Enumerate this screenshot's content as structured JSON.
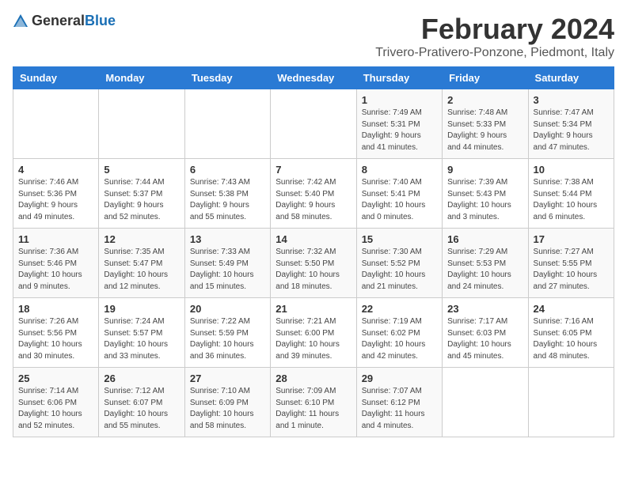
{
  "header": {
    "logo_general": "General",
    "logo_blue": "Blue",
    "title": "February 2024",
    "subtitle": "Trivero-Prativero-Ponzone, Piedmont, Italy"
  },
  "weekdays": [
    "Sunday",
    "Monday",
    "Tuesday",
    "Wednesday",
    "Thursday",
    "Friday",
    "Saturday"
  ],
  "weeks": [
    [
      {
        "day": "",
        "info": ""
      },
      {
        "day": "",
        "info": ""
      },
      {
        "day": "",
        "info": ""
      },
      {
        "day": "",
        "info": ""
      },
      {
        "day": "1",
        "info": "Sunrise: 7:49 AM\nSunset: 5:31 PM\nDaylight: 9 hours\nand 41 minutes."
      },
      {
        "day": "2",
        "info": "Sunrise: 7:48 AM\nSunset: 5:33 PM\nDaylight: 9 hours\nand 44 minutes."
      },
      {
        "day": "3",
        "info": "Sunrise: 7:47 AM\nSunset: 5:34 PM\nDaylight: 9 hours\nand 47 minutes."
      }
    ],
    [
      {
        "day": "4",
        "info": "Sunrise: 7:46 AM\nSunset: 5:36 PM\nDaylight: 9 hours\nand 49 minutes."
      },
      {
        "day": "5",
        "info": "Sunrise: 7:44 AM\nSunset: 5:37 PM\nDaylight: 9 hours\nand 52 minutes."
      },
      {
        "day": "6",
        "info": "Sunrise: 7:43 AM\nSunset: 5:38 PM\nDaylight: 9 hours\nand 55 minutes."
      },
      {
        "day": "7",
        "info": "Sunrise: 7:42 AM\nSunset: 5:40 PM\nDaylight: 9 hours\nand 58 minutes."
      },
      {
        "day": "8",
        "info": "Sunrise: 7:40 AM\nSunset: 5:41 PM\nDaylight: 10 hours\nand 0 minutes."
      },
      {
        "day": "9",
        "info": "Sunrise: 7:39 AM\nSunset: 5:43 PM\nDaylight: 10 hours\nand 3 minutes."
      },
      {
        "day": "10",
        "info": "Sunrise: 7:38 AM\nSunset: 5:44 PM\nDaylight: 10 hours\nand 6 minutes."
      }
    ],
    [
      {
        "day": "11",
        "info": "Sunrise: 7:36 AM\nSunset: 5:46 PM\nDaylight: 10 hours\nand 9 minutes."
      },
      {
        "day": "12",
        "info": "Sunrise: 7:35 AM\nSunset: 5:47 PM\nDaylight: 10 hours\nand 12 minutes."
      },
      {
        "day": "13",
        "info": "Sunrise: 7:33 AM\nSunset: 5:49 PM\nDaylight: 10 hours\nand 15 minutes."
      },
      {
        "day": "14",
        "info": "Sunrise: 7:32 AM\nSunset: 5:50 PM\nDaylight: 10 hours\nand 18 minutes."
      },
      {
        "day": "15",
        "info": "Sunrise: 7:30 AM\nSunset: 5:52 PM\nDaylight: 10 hours\nand 21 minutes."
      },
      {
        "day": "16",
        "info": "Sunrise: 7:29 AM\nSunset: 5:53 PM\nDaylight: 10 hours\nand 24 minutes."
      },
      {
        "day": "17",
        "info": "Sunrise: 7:27 AM\nSunset: 5:55 PM\nDaylight: 10 hours\nand 27 minutes."
      }
    ],
    [
      {
        "day": "18",
        "info": "Sunrise: 7:26 AM\nSunset: 5:56 PM\nDaylight: 10 hours\nand 30 minutes."
      },
      {
        "day": "19",
        "info": "Sunrise: 7:24 AM\nSunset: 5:57 PM\nDaylight: 10 hours\nand 33 minutes."
      },
      {
        "day": "20",
        "info": "Sunrise: 7:22 AM\nSunset: 5:59 PM\nDaylight: 10 hours\nand 36 minutes."
      },
      {
        "day": "21",
        "info": "Sunrise: 7:21 AM\nSunset: 6:00 PM\nDaylight: 10 hours\nand 39 minutes."
      },
      {
        "day": "22",
        "info": "Sunrise: 7:19 AM\nSunset: 6:02 PM\nDaylight: 10 hours\nand 42 minutes."
      },
      {
        "day": "23",
        "info": "Sunrise: 7:17 AM\nSunset: 6:03 PM\nDaylight: 10 hours\nand 45 minutes."
      },
      {
        "day": "24",
        "info": "Sunrise: 7:16 AM\nSunset: 6:05 PM\nDaylight: 10 hours\nand 48 minutes."
      }
    ],
    [
      {
        "day": "25",
        "info": "Sunrise: 7:14 AM\nSunset: 6:06 PM\nDaylight: 10 hours\nand 52 minutes."
      },
      {
        "day": "26",
        "info": "Sunrise: 7:12 AM\nSunset: 6:07 PM\nDaylight: 10 hours\nand 55 minutes."
      },
      {
        "day": "27",
        "info": "Sunrise: 7:10 AM\nSunset: 6:09 PM\nDaylight: 10 hours\nand 58 minutes."
      },
      {
        "day": "28",
        "info": "Sunrise: 7:09 AM\nSunset: 6:10 PM\nDaylight: 11 hours\nand 1 minute."
      },
      {
        "day": "29",
        "info": "Sunrise: 7:07 AM\nSunset: 6:12 PM\nDaylight: 11 hours\nand 4 minutes."
      },
      {
        "day": "",
        "info": ""
      },
      {
        "day": "",
        "info": ""
      }
    ]
  ]
}
